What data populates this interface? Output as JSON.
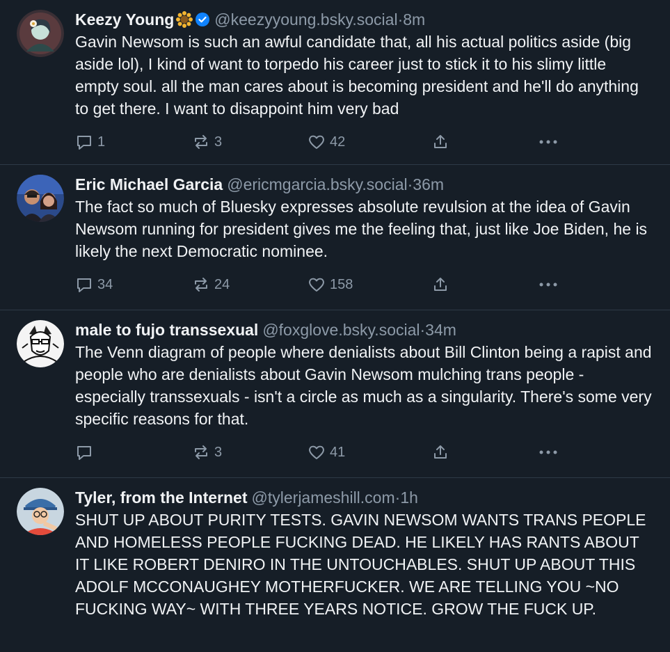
{
  "posts": [
    {
      "name": "Keezy Young",
      "handle": "@keezyyoung.bsky.social",
      "time": "8m",
      "text": "Gavin Newsom is such an awful candidate that, all his actual politics aside (big aside lol), I kind of want to torpedo his career just to stick it to his slimy little empty soul. all the man cares about is becoming president and he'll do anything to get there. I want to disappoint him very bad",
      "replies": "1",
      "reposts": "3",
      "likes": "42"
    },
    {
      "name": "Eric Michael Garcia",
      "handle": "@ericmgarcia.bsky.social",
      "time": "36m",
      "text": "The fact so much of Bluesky expresses absolute revulsion at the idea of Gavin Newsom running for president gives me the feeling that, just like Joe Biden, he is likely the next Democratic nominee.",
      "replies": "34",
      "reposts": "24",
      "likes": "158"
    },
    {
      "name": "male to fujo transsexual",
      "handle": "@foxglove.bsky.social",
      "time": "34m",
      "text": "The Venn diagram of people where denialists about Bill Clinton being a rapist and people who are denialists about Gavin Newsom mulching trans people - especially transsexuals - isn't a circle as much as a singularity. There's some very specific reasons for that.",
      "replies": "",
      "reposts": "3",
      "likes": "41"
    },
    {
      "name": "Tyler, from the Internet",
      "handle": "@tylerjameshill.com",
      "time": "1h",
      "text": "SHUT UP ABOUT PURITY TESTS. GAVIN NEWSOM WANTS TRANS PEOPLE AND HOMELESS PEOPLE FUCKING DEAD. HE LIKELY HAS RANTS ABOUT IT LIKE ROBERT DENIRO IN THE UNTOUCHABLES. SHUT UP ABOUT THIS ADOLF MCCONAUGHEY MOTHERFUCKER. WE ARE TELLING YOU ~NO FUCKING WAY~ WITH THREE YEARS NOTICE. GROW THE FUCK UP."
    }
  ],
  "separator": " · ",
  "icons": {
    "reply": "reply-icon",
    "repost": "repost-icon",
    "like": "heart-icon",
    "share": "share-icon",
    "more": "more-icon",
    "verified": "verified-badge-icon",
    "flower": "sunflower-emoji"
  },
  "colors": {
    "background": "#161e27",
    "text": "#f1f3f5",
    "muted": "#8d9aa8",
    "divider": "#2e3a47",
    "verified": "#1083fe"
  }
}
